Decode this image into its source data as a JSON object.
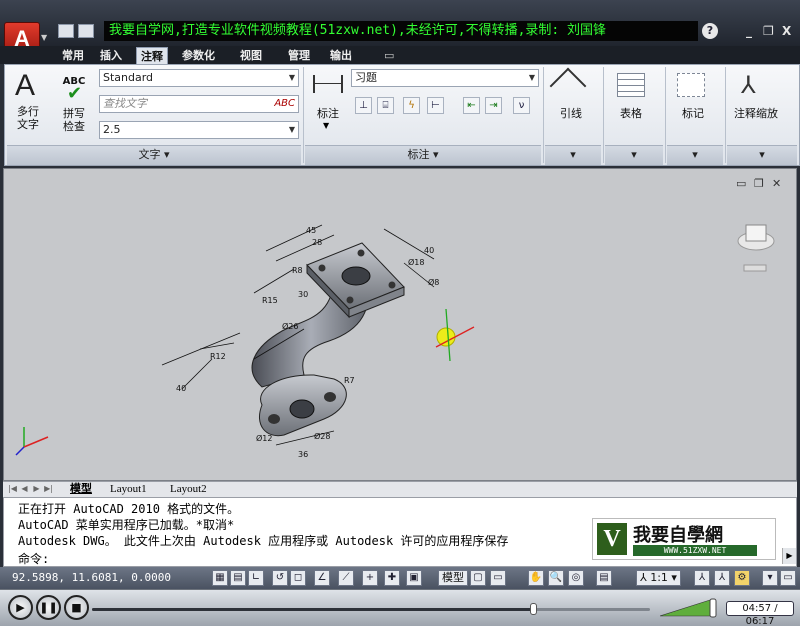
{
  "window": {
    "banner": "我要自学网,打造专业软件视频教程(51zxw.net),未经许可,不得转播,录制: 刘国锋",
    "app_logo": "A",
    "help": "?",
    "min": "_",
    "restore": "❐",
    "close": "X"
  },
  "ribbon_tabs": [
    {
      "label": "常用"
    },
    {
      "label": "插入"
    },
    {
      "label": "注释"
    },
    {
      "label": "参数化"
    },
    {
      "label": "视图"
    },
    {
      "label": "管理"
    },
    {
      "label": "输出"
    }
  ],
  "ribbon": {
    "text_panel": {
      "multiline_text_icon": "A",
      "multiline_text_line1": "多行",
      "multiline_text_line2": "文字",
      "spell_icon_text": "ABC",
      "spell_check_line1": "拼写",
      "spell_check_line2": "检查",
      "style_value": "Standard",
      "find_placeholder": "查找文字",
      "height_value": "2.5",
      "footer": "文字 ▾"
    },
    "dim_panel": {
      "dimension_label": "标注",
      "dim_style_value": "习题",
      "footer": "标注 ▾"
    },
    "leader_label": "引线",
    "table_label": "表格",
    "markup_label": "标记",
    "annotation_scale_label": "注释缩放"
  },
  "drawing": {
    "dimensions": [
      "45",
      "28",
      "40",
      "R8",
      "30",
      "R15",
      "Ø26",
      "R12",
      "40",
      "R7",
      "Ø8",
      "Ø28",
      "36",
      "Ø12",
      "Ø18"
    ]
  },
  "layout_tabs": [
    {
      "label": "模型"
    },
    {
      "label": "Layout1"
    },
    {
      "label": "Layout2"
    }
  ],
  "command": {
    "line1": "正在打开 AutoCAD 2010 格式的文件。",
    "line2": "AutoCAD 菜单实用程序已加载。*取消*",
    "line3": "Autodesk DWG。  此文件上次由 Autodesk 应用程序或 Autodesk 许可的应用程序保存",
    "prompt": "命令:",
    "watermark_title": "我要自學網",
    "watermark_url": "WWW.51ZXW.NET"
  },
  "status": {
    "coords": "92.5898,  11.6081, 0.0000",
    "model": "模型",
    "scale": "1:1"
  },
  "player": {
    "time": "04:57 / 06:17",
    "progress": 0.79
  }
}
